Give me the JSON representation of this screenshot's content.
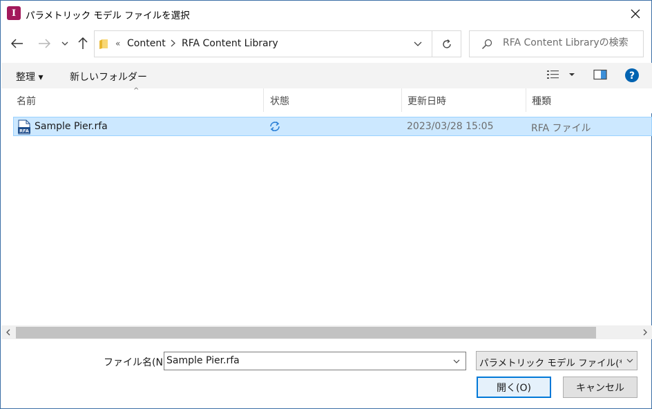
{
  "window": {
    "title": "パラメトリック モデル ファイルを選択",
    "app_icon_letter": "I",
    "app_icon_color": "#a3195b"
  },
  "address_bar": {
    "overflow_marker": "«",
    "breadcrumbs": [
      "Content",
      "RFA Content Library"
    ]
  },
  "search": {
    "placeholder": "RFA Content Libraryの検索"
  },
  "toolbar": {
    "organize_label": "整理 ▾",
    "new_folder_label": "新しいフォルダー"
  },
  "columns": {
    "name": "名前",
    "status": "状態",
    "modified": "更新日時",
    "type": "種類"
  },
  "files": [
    {
      "name": "Sample Pier.rfa",
      "icon": "rfa-file-icon",
      "icon_text": "RFA",
      "status_icon": "sync-icon",
      "modified": "2023/03/28 15:05",
      "type": "RFA ファイル",
      "selected": true
    }
  ],
  "bottom": {
    "filename_label": "ファイル名(N):",
    "filename_value": "Sample Pier.rfa",
    "filter_value": "パラメトリック モデル ファイル(*.ipt *.i",
    "open_label": "開く(O)",
    "cancel_label": "キャンセル"
  },
  "colors": {
    "selection_bg": "#cce8ff",
    "selection_border": "#99d1ff",
    "accent": "#0078d7",
    "help_blue": "#0063b1"
  }
}
